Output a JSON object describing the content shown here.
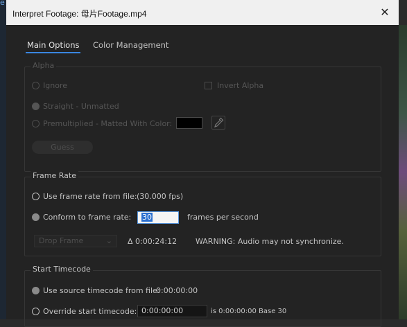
{
  "backdrop": {
    "left_letter": "e"
  },
  "window": {
    "title": "Interpret Footage: 母片Footage.mp4",
    "close_glyph": "✕"
  },
  "tabs": [
    {
      "label": "Main Options",
      "active": true
    },
    {
      "label": "Color Management",
      "active": false
    }
  ],
  "alpha": {
    "legend": "Alpha",
    "ignore": "Ignore",
    "invert": "Invert Alpha",
    "straight": "Straight - Unmatted",
    "premultiplied": "Premultiplied - Matted With Color:",
    "matte_color": "#000000",
    "guess": "Guess"
  },
  "frame_rate": {
    "legend": "Frame Rate",
    "use_from_file": "Use frame rate from file:",
    "file_fps": "(30.000 fps)",
    "conform": "Conform to frame rate:",
    "conform_value": "30",
    "fps_unit": "frames per second",
    "drop_frame": "Drop Frame",
    "delta": "Δ 0:00:24:12",
    "warning": "WARNING: Audio may not synchronize."
  },
  "start_timecode": {
    "legend": "Start Timecode",
    "use_source": "Use source timecode from file:",
    "source_value": "0:00:00:00",
    "override": "Override start timecode:",
    "override_value": "0:00:00:00",
    "is_text": "is 0:00:00:00  Base 30"
  },
  "colors": {
    "accent": "#3a86e0",
    "background": "#232323",
    "text": "#c4c4c4",
    "disabled_text": "#565656"
  }
}
